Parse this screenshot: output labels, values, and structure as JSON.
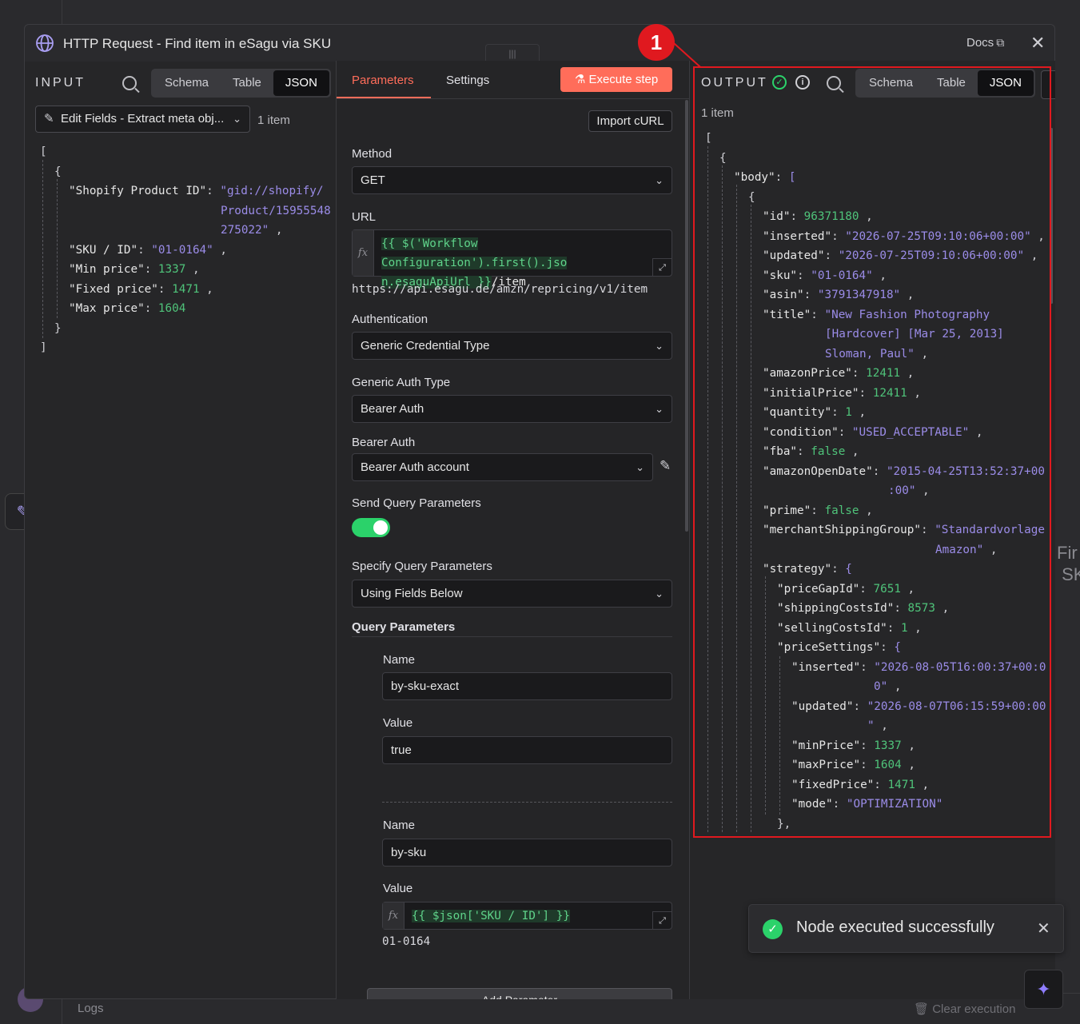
{
  "background": {
    "logs_label": "Logs",
    "clear_execution": "Clear execution",
    "node_label_partial_1": "Fir",
    "node_label_partial_2": "SK"
  },
  "modal": {
    "title": "HTTP Request - Find item in eSagu via SKU",
    "docs_label": "Docs",
    "docs_icon": "external-link-icon",
    "close_icon": "close-icon"
  },
  "input_panel": {
    "label": "INPUT",
    "view_tabs": [
      "Schema",
      "Table",
      "JSON"
    ],
    "active_view": "JSON",
    "node_select": "Edit Fields - Extract meta obj...",
    "item_count": "1 item",
    "json_lines": [
      {
        "t": "["
      },
      {
        "t": "{"
      },
      {
        "k": "\"Shopify Product ID\"",
        "v": "\"gid://shopify/",
        "vt": "s"
      },
      {
        "c": "Product/15955548",
        "vt": "s"
      },
      {
        "c": "275022\"",
        "vt": "s",
        "comma": true
      },
      {
        "k": "\"SKU / ID\"",
        "v": "\"01-0164\"",
        "vt": "s",
        "comma": true
      },
      {
        "k": "\"Min price\"",
        "v": "1337",
        "vt": "n",
        "comma": true
      },
      {
        "k": "\"Fixed price\"",
        "v": "1471",
        "vt": "n",
        "comma": true
      },
      {
        "k": "\"Max price\"",
        "v": "1604",
        "vt": "n"
      },
      {
        "t": "}"
      },
      {
        "t": "]"
      }
    ]
  },
  "params_panel": {
    "tabs": [
      "Parameters",
      "Settings"
    ],
    "active_tab": "Parameters",
    "execute_button": "Execute step",
    "import_curl": "Import cURL",
    "method_label": "Method",
    "method_value": "GET",
    "url_label": "URL",
    "url_expr_line1": "{{ $('Workflow Configuration').first().jso",
    "url_expr_line2": "n.esaguApiUrl }}",
    "url_expr_suffix": "/item",
    "url_resolved": "https://api.esagu.de/amzn/repricing/v1/item",
    "auth_label": "Authentication",
    "auth_value": "Generic Credential Type",
    "generic_auth_label": "Generic Auth Type",
    "generic_auth_value": "Bearer Auth",
    "bearer_label": "Bearer Auth",
    "bearer_value": "Bearer Auth account",
    "send_query_label": "Send Query Parameters",
    "send_query_enabled": true,
    "specify_query_label": "Specify Query Parameters",
    "specify_query_value": "Using Fields Below",
    "query_params_label": "Query Parameters",
    "query_params": [
      {
        "name_label": "Name",
        "name": "by-sku-exact",
        "value_label": "Value",
        "value": "true"
      },
      {
        "name_label": "Name",
        "name": "by-sku",
        "value_label": "Value",
        "value_expr": "{{ $json['SKU / ID'] }}",
        "value_resolved": "01-0164"
      }
    ],
    "add_parameter": "Add Parameter"
  },
  "output_panel": {
    "label": "OUTPUT",
    "view_tabs": [
      "Schema",
      "Table",
      "JSON"
    ],
    "active_view": "JSON",
    "item_count": "1 item",
    "json_lines": [
      {
        "d": 0,
        "t": "["
      },
      {
        "d": 1,
        "t": "{"
      },
      {
        "d": 2,
        "k": "\"body\"",
        "v": "[",
        "vt": "b"
      },
      {
        "d": 3,
        "t": "{"
      },
      {
        "d": 4,
        "k": "\"id\"",
        "v": "96371180",
        "vt": "n",
        "comma": true
      },
      {
        "d": 4,
        "k": "\"inserted\"",
        "v": "\"2026-07-25T09:10:06+00:00\"",
        "vt": "s",
        "comma": true
      },
      {
        "d": 4,
        "k": "\"updated\"",
        "v": "\"2026-07-25T09:10:06+00:00\"",
        "vt": "s",
        "comma": true
      },
      {
        "d": 4,
        "k": "\"sku\"",
        "v": "\"01-0164\"",
        "vt": "s",
        "comma": true
      },
      {
        "d": 4,
        "k": "\"asin\"",
        "v": "\"3791347918\"",
        "vt": "s",
        "comma": true
      },
      {
        "d": 4,
        "k": "\"title\"",
        "v": "\"New Fashion Photography",
        "vt": "s"
      },
      {
        "d": 4,
        "c": "[Hardcover] [Mar 25, 2013]",
        "vt": "s",
        "ci": 78
      },
      {
        "d": 4,
        "c": "Sloman, Paul\"",
        "vt": "s",
        "ci": 78,
        "comma": true
      },
      {
        "d": 4,
        "k": "\"amazonPrice\"",
        "v": "12411",
        "vt": "n",
        "comma": true
      },
      {
        "d": 4,
        "k": "\"initialPrice\"",
        "v": "12411",
        "vt": "n",
        "comma": true
      },
      {
        "d": 4,
        "k": "\"quantity\"",
        "v": "1",
        "vt": "n",
        "comma": true
      },
      {
        "d": 4,
        "k": "\"condition\"",
        "v": "\"USED_ACCEPTABLE\"",
        "vt": "s",
        "comma": true
      },
      {
        "d": 4,
        "k": "\"fba\"",
        "v": "false",
        "vt": "n",
        "comma": true
      },
      {
        "d": 4,
        "k": "\"amazonOpenDate\"",
        "v": "\"2015-04-25T13:52:37+00",
        "vt": "s"
      },
      {
        "d": 4,
        "c": ":00\"",
        "vt": "s",
        "ci": 157,
        "comma": true
      },
      {
        "d": 4,
        "k": "\"prime\"",
        "v": "false",
        "vt": "n",
        "comma": true
      },
      {
        "d": 4,
        "k": "\"merchantShippingGroup\"",
        "v": "\"Standardvorlage",
        "vt": "s"
      },
      {
        "d": 4,
        "c": "Amazon\"",
        "vt": "s",
        "ci": 216,
        "comma": true
      },
      {
        "d": 4,
        "k": "\"strategy\"",
        "v": "{",
        "vt": "b"
      },
      {
        "d": 5,
        "k": "\"priceGapId\"",
        "v": "7651",
        "vt": "n",
        "comma": true
      },
      {
        "d": 5,
        "k": "\"shippingCostsId\"",
        "v": "8573",
        "vt": "n",
        "comma": true
      },
      {
        "d": 5,
        "k": "\"sellingCostsId\"",
        "v": "1",
        "vt": "n",
        "comma": true
      },
      {
        "d": 5,
        "k": "\"priceSettings\"",
        "v": "{",
        "vt": "b"
      },
      {
        "d": 6,
        "k": "\"inserted\"",
        "v": "\"2026-08-05T16:00:37+00:0",
        "vt": "s"
      },
      {
        "d": 6,
        "c": "0\"",
        "vt": "s",
        "ci": 103,
        "comma": true
      },
      {
        "d": 6,
        "k": "\"updated\"",
        "v": "\"2026-08-07T06:15:59+00:00",
        "vt": "s"
      },
      {
        "d": 6,
        "c": "\"",
        "vt": "s",
        "ci": 95,
        "comma": true
      },
      {
        "d": 6,
        "k": "\"minPrice\"",
        "v": "1337",
        "vt": "n",
        "comma": true
      },
      {
        "d": 6,
        "k": "\"maxPrice\"",
        "v": "1604",
        "vt": "n",
        "comma": true
      },
      {
        "d": 6,
        "k": "\"fixedPrice\"",
        "v": "1471",
        "vt": "n",
        "comma": true
      },
      {
        "d": 6,
        "k": "\"mode\"",
        "v": "\"OPTIMIZATION\"",
        "vt": "s"
      },
      {
        "d": 5,
        "t": "},"
      }
    ]
  },
  "annotation": {
    "badge": "1"
  },
  "toast": {
    "message": "Node executed successfully",
    "icon": "check-circle-icon"
  },
  "colors": {
    "accent": "#ff6d5a",
    "success": "#2bd26a",
    "annotation": "#e0191f",
    "json_string": "#9b8ce8",
    "json_number": "#4fc37a"
  }
}
